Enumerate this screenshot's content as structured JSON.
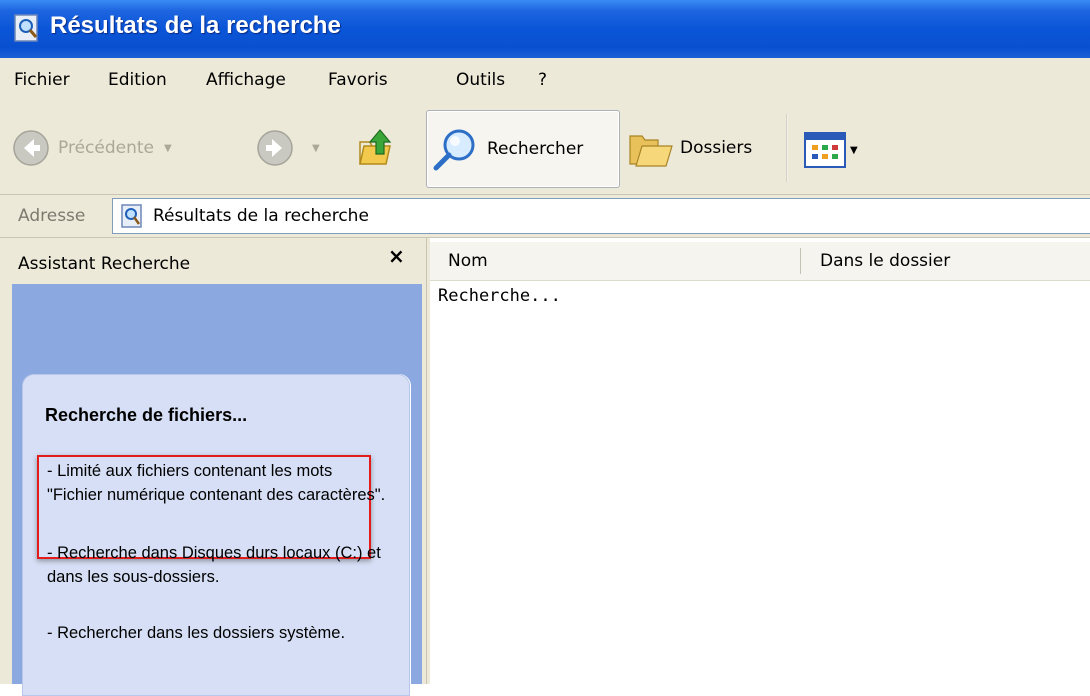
{
  "window": {
    "title": "Résultats de la recherche",
    "icon": "search-results-icon"
  },
  "menu": [
    "Fichier",
    "Edition",
    "Affichage",
    "Favoris",
    "Outils",
    "?"
  ],
  "toolbar": {
    "back_label": "Précédente",
    "search_label": "Rechercher",
    "folders_label": "Dossiers",
    "icons": [
      "back-arrow-icon",
      "forward-arrow-icon",
      "up-folder-icon",
      "magnifier-icon",
      "folders-icon",
      "views-icon"
    ]
  },
  "address": {
    "label": "Adresse",
    "value": "Résultats de la recherche"
  },
  "assistant": {
    "title": "Assistant Recherche",
    "close": "×",
    "card_title": "Recherche de fichiers...",
    "items": [
      "- Limité aux fichiers contenant les mots \"Fichier numérique contenant des caractères\".",
      "- Recherche dans Disques durs locaux (C:) et dans les sous-dossiers.",
      "- Rechercher dans les dossiers système."
    ]
  },
  "results": {
    "columns": [
      "Nom",
      "Dans le dossier"
    ],
    "status": "Recherche..."
  },
  "colors": {
    "titlebar": "#0a55d8",
    "chrome": "#ece9d8",
    "pane_blue": "#8ba8e1",
    "card": "#d6dff5",
    "highlight": "#e21b1b"
  }
}
